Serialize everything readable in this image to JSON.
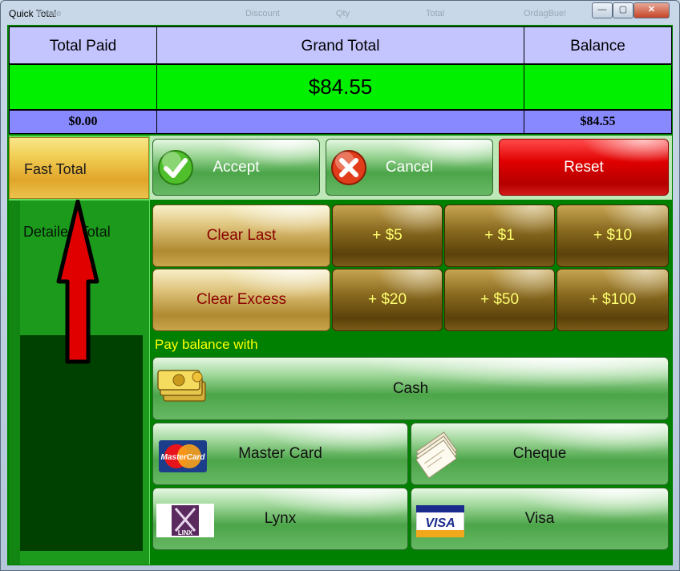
{
  "window": {
    "title": "Quick Total",
    "ghost_headers": [
      "Name",
      "Discount",
      "Qty",
      "Total",
      "OrdagBue!"
    ]
  },
  "totals": {
    "total_paid_label": "Total Paid",
    "grand_total_label": "Grand Total",
    "balance_label": "Balance",
    "grand_total_value": "$84.55",
    "total_paid_value": "$0.00",
    "balance_value": "$84.55"
  },
  "tabs": {
    "fast_total": "Fast Total",
    "detailed_total": "Detailed Total"
  },
  "actions": {
    "accept": "Accept",
    "cancel": "Cancel",
    "reset": "Reset"
  },
  "amount_buttons": {
    "clear_last": "Clear Last",
    "clear_excess": "Clear Excess",
    "plus5": "+ $5",
    "plus1": "+ $1",
    "plus10": "+ $10",
    "plus20": "+ $20",
    "plus50": "+ $50",
    "plus100": "+ $100"
  },
  "payment": {
    "title": "Pay balance with",
    "cash": "Cash",
    "master_card": "Master Card",
    "cheque": "Cheque",
    "lynx": "Lynx",
    "visa": "Visa"
  },
  "logos": {
    "mastercard_text": "MasterCard",
    "linx_text": "LINX",
    "visa_text": "VISA"
  },
  "colors": {
    "header_bg": "#c4c4ff",
    "grand_total_bg": "#00f000",
    "subtotal_bg": "#8888ff",
    "panel_bg": "#008000",
    "reset_red": "#e00000",
    "pay_title_yellow": "#ffff00",
    "annotation_arrow": "#e00000"
  },
  "icons": {
    "accept": "check-icon",
    "cancel": "x-icon",
    "cash": "cash-icon",
    "master_card": "mastercard-logo",
    "cheque": "cheque-icon",
    "lynx": "linx-logo",
    "visa": "visa-logo",
    "annotation": "up-arrow-annotation"
  }
}
